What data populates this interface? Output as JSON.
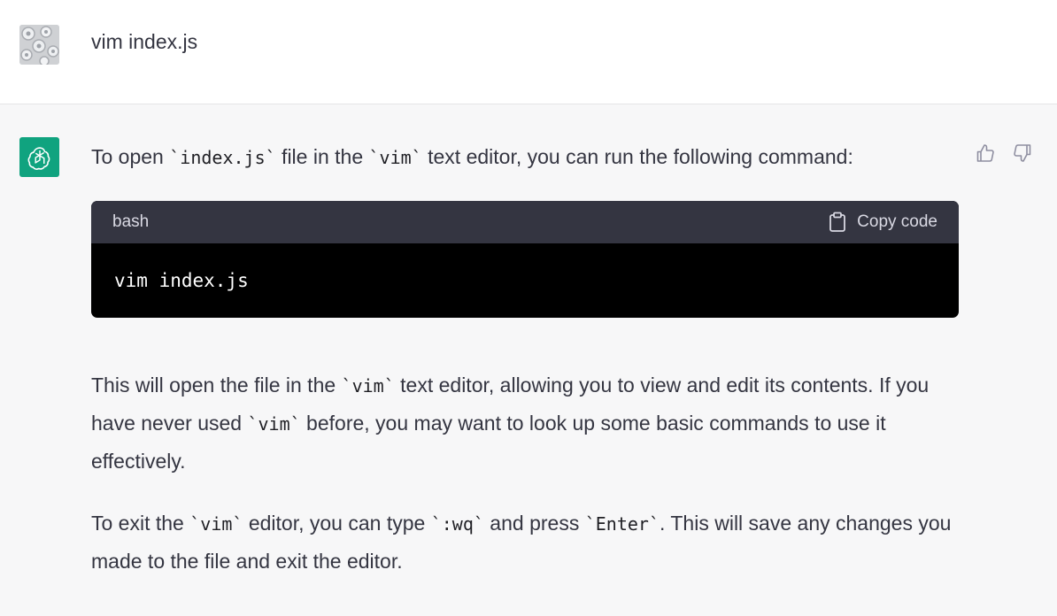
{
  "user_message": {
    "text": "vim index.js"
  },
  "assistant_message": {
    "intro": {
      "t1": "To open ",
      "c1": "`index.js`",
      "t2": " file in the ",
      "c2": "`vim`",
      "t3": " text editor, you can run the following command:"
    },
    "code_block": {
      "language": "bash",
      "copy_label": "Copy code",
      "code": "vim index.js"
    },
    "para1": {
      "t1": "This will open the file in the ",
      "c1": "`vim`",
      "t2": " text editor, allowing you to view and edit its contents. If you have never used ",
      "c2": "`vim`",
      "t3": " before, you may want to look up some basic commands to use it effectively."
    },
    "para2": {
      "t1": "To exit the ",
      "c1": "`vim`",
      "t2": " editor, you can type ",
      "c2": "`:wq`",
      "t3": " and press ",
      "c3": "`Enter`",
      "t4": ". This will save any changes you made to the file and exit the editor."
    }
  },
  "icons": {
    "user_avatar": "user-avatar-image",
    "assistant_avatar": "openai-logo-icon",
    "thumbs_up": "thumbs-up-icon",
    "thumbs_down": "thumbs-down-icon",
    "clipboard": "clipboard-icon"
  },
  "colors": {
    "assistant_avatar_bg": "#10a37f",
    "code_header_bg": "#343541",
    "code_body_bg": "#000000",
    "page_bg": "#f7f7f8",
    "user_row_bg": "#ffffff",
    "text": "#343541"
  }
}
